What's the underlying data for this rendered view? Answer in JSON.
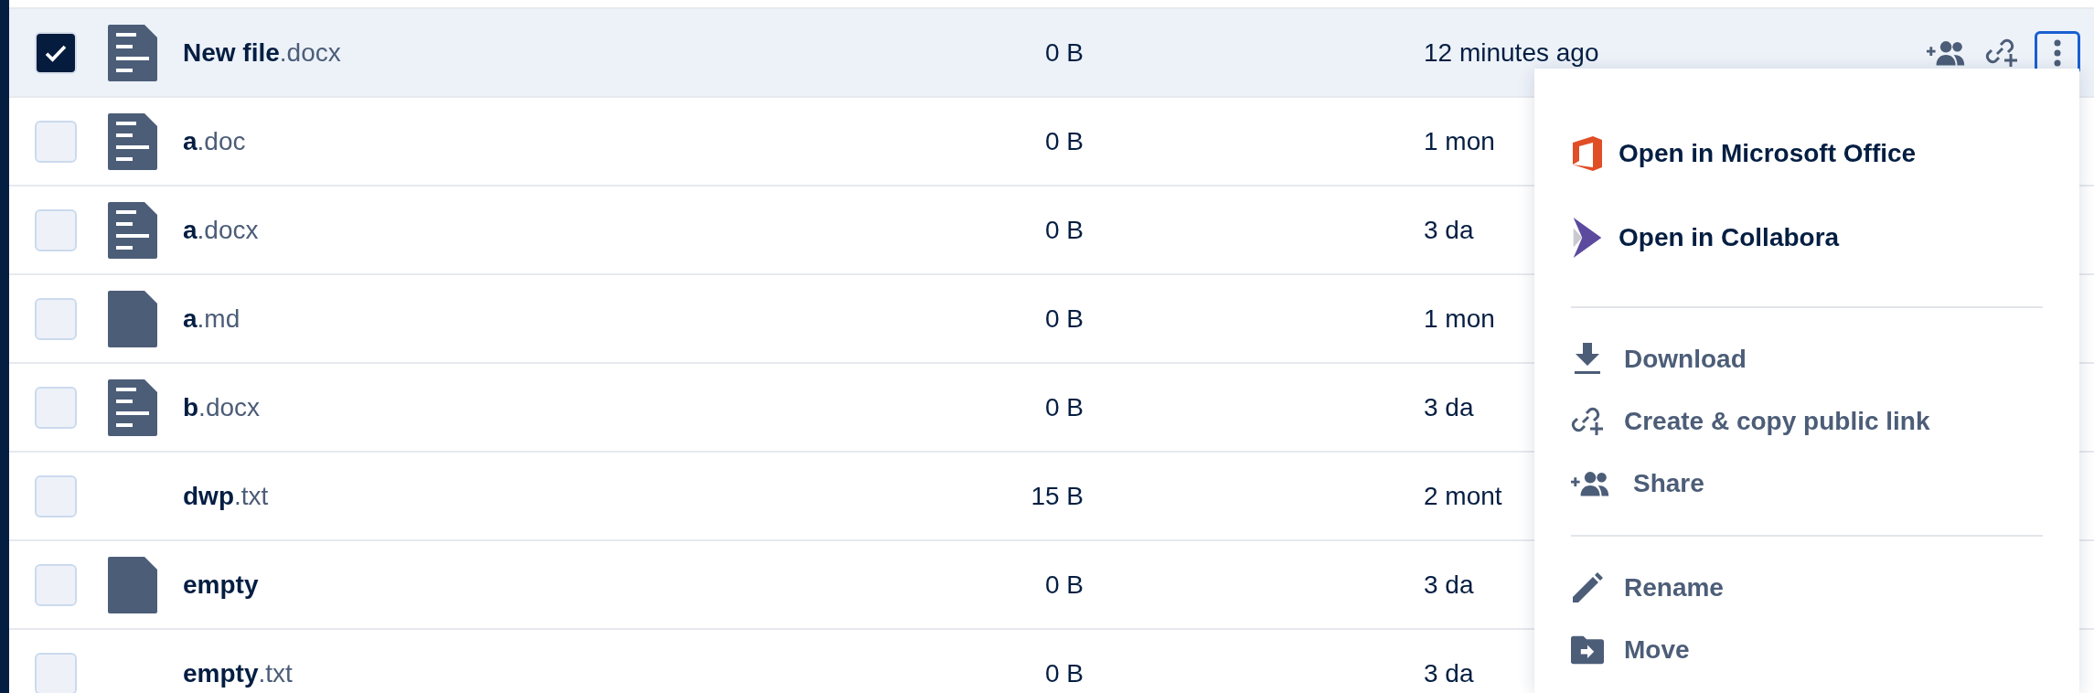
{
  "rows": [
    {
      "name": "New file",
      "ext": ".docx",
      "size": "0 B",
      "date": "12 minutes ago",
      "selected": true,
      "kind": "lines",
      "show_actions": true
    },
    {
      "name": "a",
      "ext": ".doc",
      "size": "0 B",
      "date": "1 mon",
      "selected": false,
      "kind": "lines",
      "show_actions": false
    },
    {
      "name": "a",
      "ext": ".docx",
      "size": "0 B",
      "date": "3 da",
      "selected": false,
      "kind": "lines",
      "show_actions": false
    },
    {
      "name": "a",
      "ext": ".md",
      "size": "0 B",
      "date": "1 mon",
      "selected": false,
      "kind": "blank",
      "show_actions": false
    },
    {
      "name": "b",
      "ext": ".docx",
      "size": "0 B",
      "date": "3 da",
      "selected": false,
      "kind": "lines",
      "show_actions": false
    },
    {
      "name": "dwp",
      "ext": ".txt",
      "size": "15 B",
      "date": "2 mont",
      "selected": false,
      "kind": "none",
      "show_actions": false
    },
    {
      "name": "empty",
      "size": "0 B",
      "date": "3 da",
      "selected": false,
      "kind": "blank",
      "show_actions": false
    },
    {
      "name": "empty",
      "ext": ".txt",
      "size": "0 B",
      "date": "3 da",
      "selected": false,
      "kind": "none",
      "show_actions": false
    }
  ],
  "menu": {
    "groups": [
      [
        {
          "label": "Open in Microsoft Office",
          "kind": "office"
        },
        {
          "label": "Open in Collabora",
          "kind": "collabora"
        }
      ],
      [
        {
          "label": "Download",
          "kind": "download"
        },
        {
          "label": "Create & copy public link",
          "kind": "link"
        },
        {
          "label": "Share",
          "kind": "share"
        }
      ],
      [
        {
          "label": "Rename",
          "kind": "rename"
        },
        {
          "label": "Move",
          "kind": "move"
        }
      ]
    ]
  }
}
